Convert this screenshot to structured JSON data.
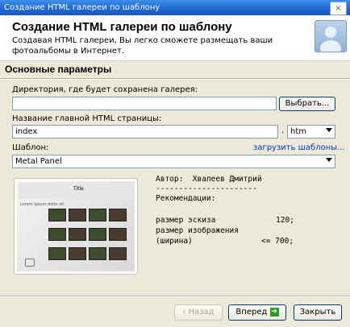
{
  "window": {
    "title": "Создание HTML галереи по шаблону",
    "close_glyph": "×"
  },
  "header": {
    "title": "Создание HTML галереи по шаблону",
    "subtitle": "Создавая HTML галереи, Вы легко сможете размещать ваши фотоальбомы в Интернет."
  },
  "section": {
    "title": "Основные параметры"
  },
  "fields": {
    "directory_label": "Директория, где будет сохранена галерея:",
    "directory_value": "",
    "browse_button": "Выбрать...",
    "page_name_label": "Название главной HTML страницы:",
    "page_name_value": "index",
    "dot": ".",
    "extension_value": "htm",
    "template_label": "Шаблон:",
    "load_templates_link": "загрузить шаблоны...",
    "template_value": "Metal Panel"
  },
  "preview": {
    "title": "Title",
    "caption": "Lorem ipsum dolor sit"
  },
  "info": {
    "author_line": "Автор:  Хвалеев Дмитрий",
    "separator": "----------------------",
    "recommendations": "Рекомендации:",
    "thumb_size_label": "размер эскиза",
    "thumb_size_value": "120;",
    "image_size_label": "размер изображения",
    "width_label": "(ширина)",
    "width_value": "<= 700;"
  },
  "buttons": {
    "back": "Назад",
    "next": "Вперед",
    "close": "Закрыть"
  },
  "colors": {
    "titlebar": "#1e66d0",
    "next_arrow": "#2e9a2e"
  }
}
